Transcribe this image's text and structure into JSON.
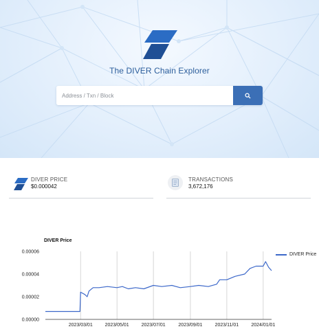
{
  "hero": {
    "title": "The DIVER Chain Explorer",
    "logo_icon": "diver-logo-icon",
    "search": {
      "placeholder": "Address / Txn / Block",
      "button_icon": "search-icon"
    },
    "colors": {
      "brand": "#2b5d9b",
      "button": "#3b6fb6"
    }
  },
  "stats": {
    "price": {
      "label": "DIVER PRICE",
      "value": "$0.000042",
      "icon": "diver-logo-icon"
    },
    "transactions": {
      "label": "TRANSACTIONS",
      "value": "3,672,176",
      "icon": "document-icon"
    }
  },
  "chart_data": {
    "type": "line",
    "title": "DIVER Price",
    "xlabel": "",
    "ylabel": "",
    "ylim": [
      0,
      6e-05
    ],
    "y_ticks": [
      "0.00000",
      "0.00002",
      "0.00004",
      "0.00006"
    ],
    "x_ticks": [
      "2023/03/01",
      "2023/05/01",
      "2023/07/01",
      "2023/09/01",
      "2023/11/01",
      "2024/01/01"
    ],
    "xlim": [
      "2023/01/01",
      "2024/01/15"
    ],
    "grid": "vertical",
    "legend": "right",
    "color": "#3b67c9",
    "series": [
      {
        "name": "DIVER Price",
        "x": [
          "2023/01/01",
          "2023/02/28",
          "2023/03/01",
          "2023/03/08",
          "2023/03/12",
          "2023/03/15",
          "2023/03/22",
          "2023/04/01",
          "2023/04/15",
          "2023/05/01",
          "2023/05/10",
          "2023/05/20",
          "2023/06/01",
          "2023/06/15",
          "2023/07/01",
          "2023/07/15",
          "2023/08/01",
          "2023/08/15",
          "2023/09/01",
          "2023/09/15",
          "2023/10/01",
          "2023/10/15",
          "2023/10/20",
          "2023/11/01",
          "2023/11/15",
          "2023/12/01",
          "2023/12/10",
          "2023/12/20",
          "2024/01/01",
          "2024/01/05",
          "2024/01/10",
          "2024/01/15"
        ],
        "y": [
          7e-06,
          7e-06,
          2.4e-05,
          2.2e-05,
          2e-05,
          2.5e-05,
          2.8e-05,
          2.8e-05,
          2.9e-05,
          2.8e-05,
          2.9e-05,
          2.7e-05,
          2.8e-05,
          2.7e-05,
          3e-05,
          2.9e-05,
          3e-05,
          2.8e-05,
          2.9e-05,
          3e-05,
          2.9e-05,
          3.1e-05,
          3.5e-05,
          3.5e-05,
          3.8e-05,
          4e-05,
          4.5e-05,
          4.7e-05,
          4.7e-05,
          5.1e-05,
          4.6e-05,
          4.3e-05
        ]
      }
    ]
  }
}
